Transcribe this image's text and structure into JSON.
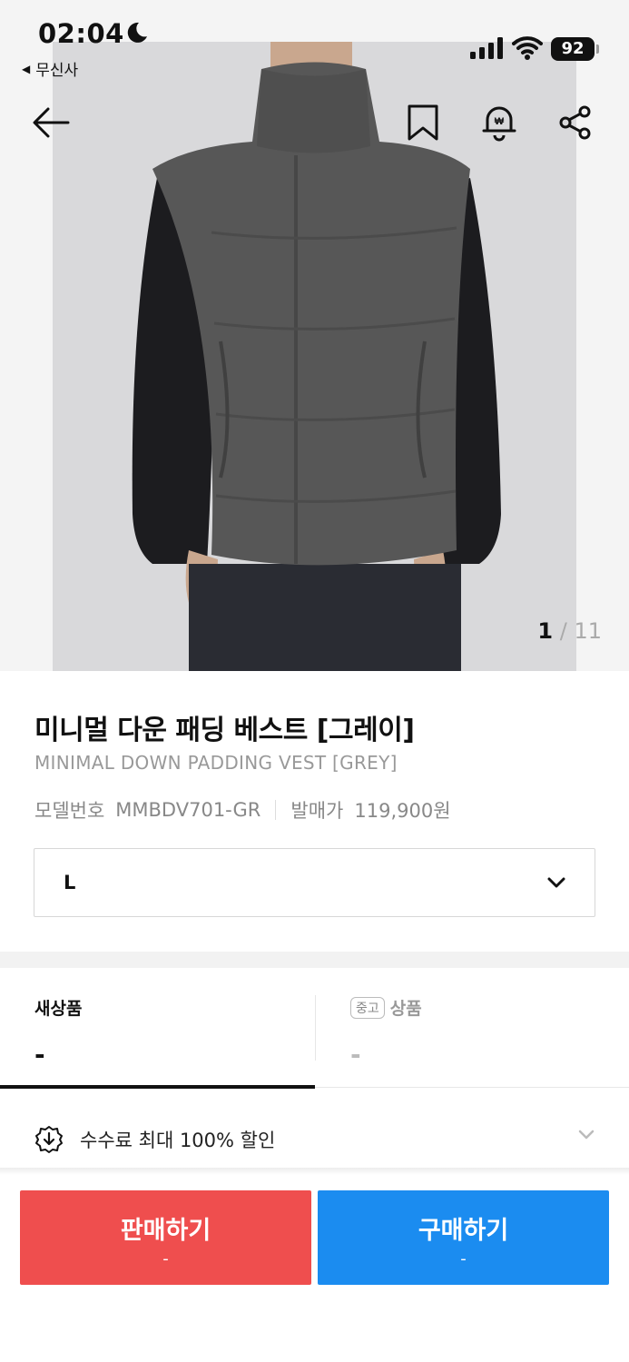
{
  "status_bar": {
    "time": "02:04",
    "back_app": "무신사",
    "battery": "92"
  },
  "gallery": {
    "current_page": "1",
    "separator": "/",
    "total_pages": "11"
  },
  "product": {
    "name_ko": "미니멀 다운 패딩 베스트 [그레이]",
    "name_en": "MINIMAL DOWN PADDING VEST [GREY]",
    "model_label": "모델번호",
    "model_number": "MMBDV701-GR",
    "release_price_label": "발매가",
    "release_price": "119,900원"
  },
  "size_select": {
    "selected": "L"
  },
  "tabs": {
    "new_label": "새상품",
    "new_price": "-",
    "used_badge": "중고",
    "used_label": "상품",
    "used_price": "-"
  },
  "fee": {
    "text": "수수료 최대 100% 할인"
  },
  "actions": {
    "sell_label": "판매하기",
    "sell_price": "-",
    "buy_label": "구매하기",
    "buy_price": "-"
  },
  "colors": {
    "sell": "#ef4e4e",
    "buy": "#1b8cf0",
    "vest": "#575757"
  },
  "icons": [
    "back-arrow-icon",
    "bookmark-icon",
    "price-alert-bell-icon",
    "share-icon",
    "download-circle-icon",
    "chevron-down-icon",
    "moon-icon",
    "signal-icon",
    "wifi-icon"
  ]
}
